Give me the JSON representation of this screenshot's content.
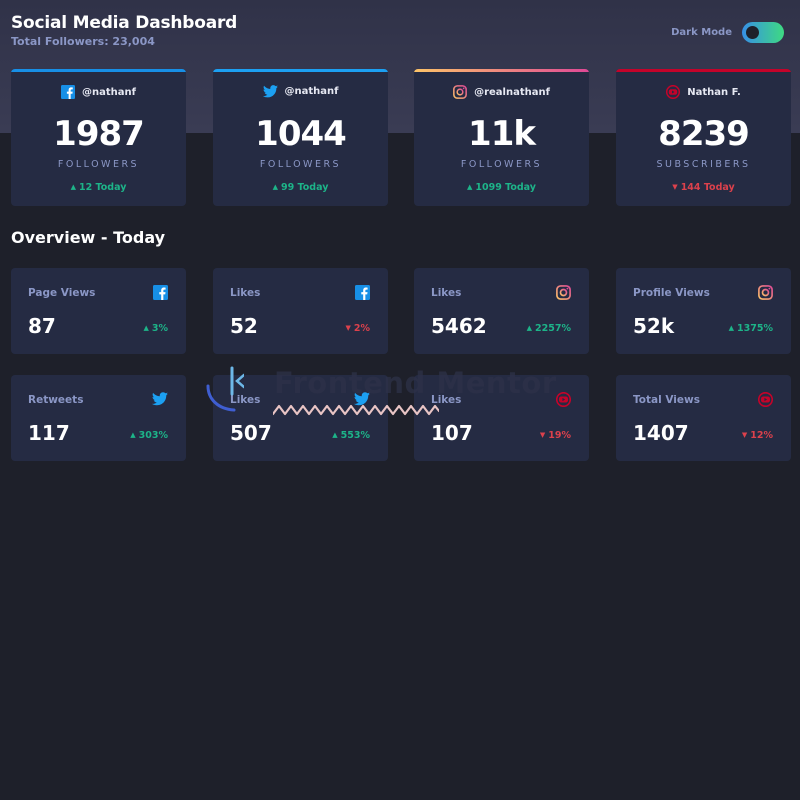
{
  "header": {
    "title": "Social Media Dashboard",
    "subtitle": "Total Followers: 23,004",
    "dark_mode_label": "Dark Mode",
    "dark_mode_on": true
  },
  "colors": {
    "background": "#1e202a",
    "top_band": "#33354a",
    "card": "#252b43",
    "text_muted": "#8b97c6",
    "up": "#1db489",
    "down": "#dc414c",
    "facebook": "#178fe6",
    "twitter": "#1ca0f2",
    "instagram_start": "#fdc468",
    "instagram_end": "#df4996",
    "youtube": "#c4032a"
  },
  "followers": [
    {
      "platform": "facebook",
      "icon": "facebook-icon",
      "handle": "@nathanf",
      "count": "1987",
      "unit": "FOLLOWERS",
      "change": "12 Today",
      "trend": "up"
    },
    {
      "platform": "twitter",
      "icon": "twitter-icon",
      "handle": "@nathanf",
      "count": "1044",
      "unit": "FOLLOWERS",
      "change": "99 Today",
      "trend": "up"
    },
    {
      "platform": "instagram",
      "icon": "instagram-icon",
      "handle": "@realnathanf",
      "count": "11k",
      "unit": "FOLLOWERS",
      "change": "1099 Today",
      "trend": "up"
    },
    {
      "platform": "youtube",
      "icon": "youtube-icon",
      "handle": "Nathan F.",
      "count": "8239",
      "unit": "SUBSCRIBERS",
      "change": "144 Today",
      "trend": "down"
    }
  ],
  "overview": {
    "title": "Overview - Today",
    "items": [
      {
        "metric": "Page Views",
        "icon": "facebook-icon",
        "value": "87",
        "change": "3%",
        "trend": "up"
      },
      {
        "metric": "Likes",
        "icon": "facebook-icon",
        "value": "52",
        "change": "2%",
        "trend": "down"
      },
      {
        "metric": "Likes",
        "icon": "instagram-icon",
        "value": "5462",
        "change": "2257%",
        "trend": "up"
      },
      {
        "metric": "Profile Views",
        "icon": "instagram-icon",
        "value": "52k",
        "change": "1375%",
        "trend": "up"
      },
      {
        "metric": "Retweets",
        "icon": "twitter-icon",
        "value": "117",
        "change": "303%",
        "trend": "up"
      },
      {
        "metric": "Likes",
        "icon": "twitter-icon",
        "value": "507",
        "change": "553%",
        "trend": "up"
      },
      {
        "metric": "Likes",
        "icon": "youtube-icon",
        "value": "107",
        "change": "19%",
        "trend": "down"
      },
      {
        "metric": "Total Views",
        "icon": "youtube-icon",
        "value": "1407",
        "change": "12%",
        "trend": "down"
      }
    ]
  },
  "watermark": {
    "text": "Frontend Mentor",
    "icon": "frontend-mentor-logo-icon"
  }
}
